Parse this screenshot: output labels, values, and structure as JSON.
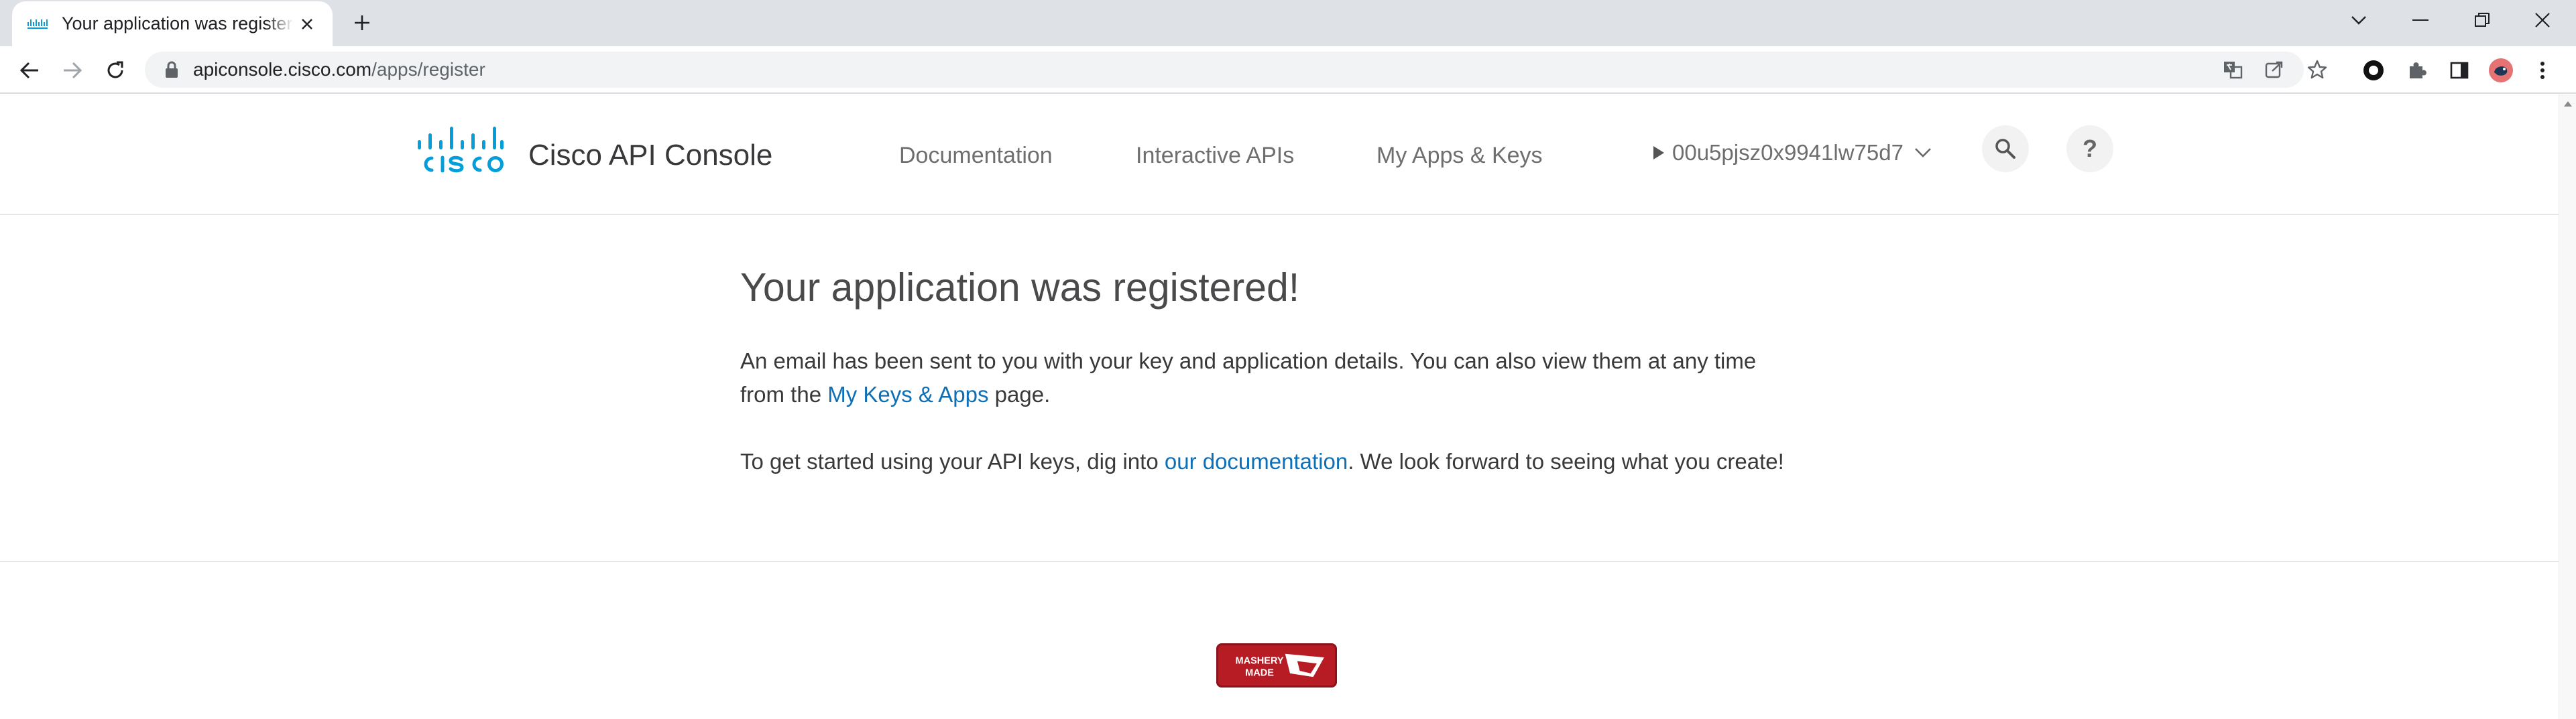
{
  "browser": {
    "tab_title": "Your application was registered!",
    "url_domain": "apiconsole.cisco.com",
    "url_path": "/apps/register"
  },
  "header": {
    "site_title": "Cisco API Console",
    "nav": [
      "Documentation",
      "Interactive APIs",
      "My Apps & Keys"
    ],
    "user": "00u5pjsz0x9941lw75d7"
  },
  "main": {
    "headline": "Your application was registered!",
    "para1_line1": "An email has been sent to you with your key and application details. You can also view them at any time",
    "para1_line2_before": "from the ",
    "para1_link": "My Keys & Apps",
    "para1_line2_after": " page.",
    "para2_before": "To get started using your API keys, dig into ",
    "para2_link": "our documentation",
    "para2_after": ". We look forward to seeing what you create!"
  },
  "footer": {
    "badge_text": [
      "MASHERY",
      "MADE"
    ]
  },
  "colors": {
    "cisco_blue": "#049fd9",
    "link": "#0d6fb5",
    "mashery_red": "#b71c24"
  }
}
